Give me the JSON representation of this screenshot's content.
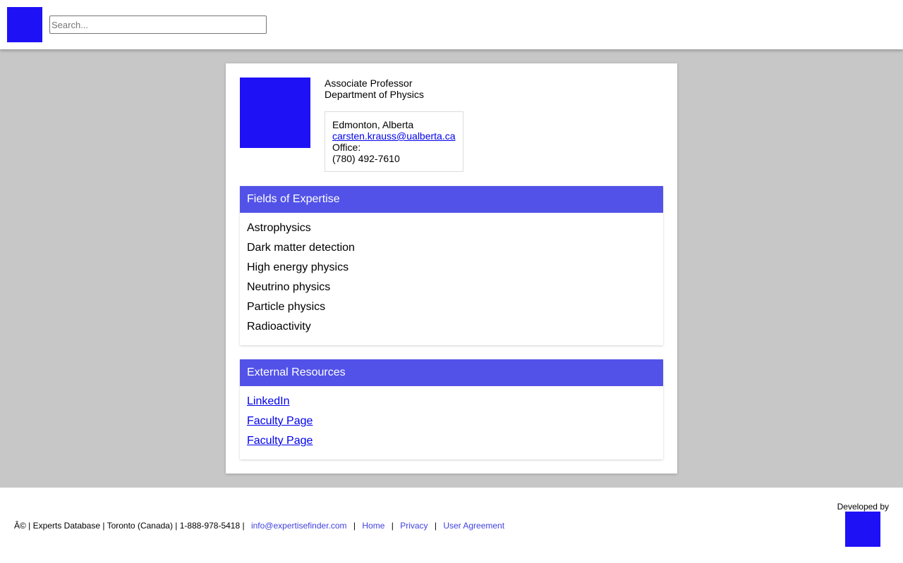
{
  "header": {
    "logo_icon": "logo-icon",
    "search_placeholder": "Search..."
  },
  "profile": {
    "photo_icon": "profile-photo",
    "position": "Associate Professor",
    "department": "Department of Physics",
    "location": "Edmonton, Alberta",
    "email": "carsten.krauss@ualberta.ca",
    "office_label": "Office:",
    "phone": "(780) 492-7610"
  },
  "expertise": {
    "heading": "Fields of Expertise",
    "items": [
      "Astrophysics",
      "Dark matter detection",
      "High energy physics",
      "Neutrino physics",
      "Particle physics",
      "Radioactivity"
    ]
  },
  "resources": {
    "heading": "External Resources",
    "links": [
      "LinkedIn",
      "Faculty Page",
      "Faculty Page"
    ]
  },
  "footer": {
    "copyright": "Â© | Experts Database | Toronto (Canada) | 1-888-978-5418 |",
    "email": "info@expertisefinder.com",
    "home": "Home",
    "privacy": "Privacy",
    "agreement": "User Agreement",
    "separator": "|",
    "developed_by": "Developed by"
  },
  "colors": {
    "accent": "#5252e8",
    "logo": "#1f11f6",
    "background": "#c7c7c7"
  }
}
